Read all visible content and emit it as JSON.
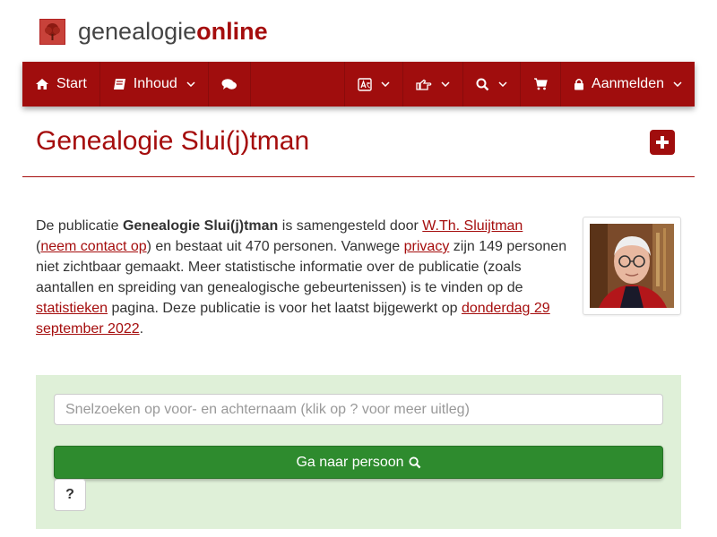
{
  "brand": {
    "part1": "genealogie",
    "part2": "online"
  },
  "nav": {
    "start": "Start",
    "inhoud": "Inhoud",
    "aanmelden": "Aanmelden"
  },
  "page": {
    "title": "Genealogie Slui(j)tman"
  },
  "intro": {
    "t1": "De publicatie ",
    "pub_name": "Genealogie Slui(j)tman",
    "t2": " is samengesteld door ",
    "author": "W.Th. Sluijtman",
    "t3": "(",
    "contact": "neem contact op",
    "t4": ") en bestaat uit 470 personen. Vanwege ",
    "privacy": "privacy",
    "t5": " zijn 149 personen niet zichtbaar gemaakt. Meer statistische informatie over de publicatie (zoals aantallen en spreiding van genealogische gebeurtenissen) is te vinden op de ",
    "stats": "statistieken",
    "t6": " pagina. Deze publicatie is voor het laatst bijgewerkt op ",
    "date": "donderdag 29 september 2022",
    "t7": "."
  },
  "search": {
    "placeholder": "Snelzoeken op voor- en achternaam (klik op ? voor meer uitleg)",
    "go_label": "Ga naar persoon",
    "help_label": "?"
  },
  "colors": {
    "brand": "#a00d0d",
    "panel": "#dff0d8",
    "go": "#2e8b2e"
  }
}
